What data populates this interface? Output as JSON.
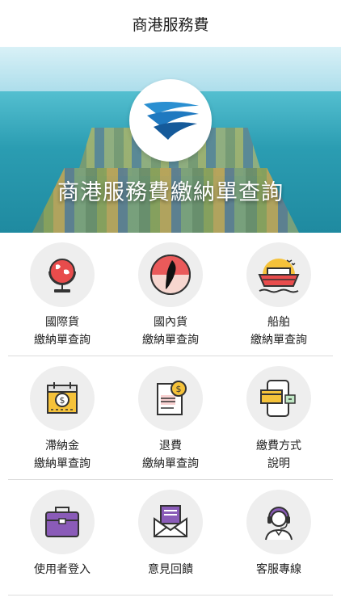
{
  "header": {
    "title": "商港服務費"
  },
  "banner": {
    "title": "商港服務費繳納單查詢"
  },
  "menu": [
    {
      "line1": "國際貨",
      "line2": "繳納單查詢",
      "icon": "globe-icon"
    },
    {
      "line1": "國內貨",
      "line2": "繳納單查詢",
      "icon": "taiwan-map-icon"
    },
    {
      "line1": "船舶",
      "line2": "繳納單查詢",
      "icon": "cruise-ship-icon"
    },
    {
      "line1": "滯納金",
      "line2": "繳納單查詢",
      "icon": "calendar-dollar-icon"
    },
    {
      "line1": "退費",
      "line2": "繳納單查詢",
      "icon": "refund-document-icon"
    },
    {
      "line1": "繳費方式",
      "line2": "說明",
      "icon": "payment-methods-icon"
    },
    {
      "line1": "使用者登入",
      "line2": "",
      "icon": "briefcase-icon"
    },
    {
      "line1": "意見回饋",
      "line2": "",
      "icon": "envelope-icon"
    },
    {
      "line1": "客服專線",
      "line2": "",
      "icon": "customer-service-icon"
    }
  ]
}
